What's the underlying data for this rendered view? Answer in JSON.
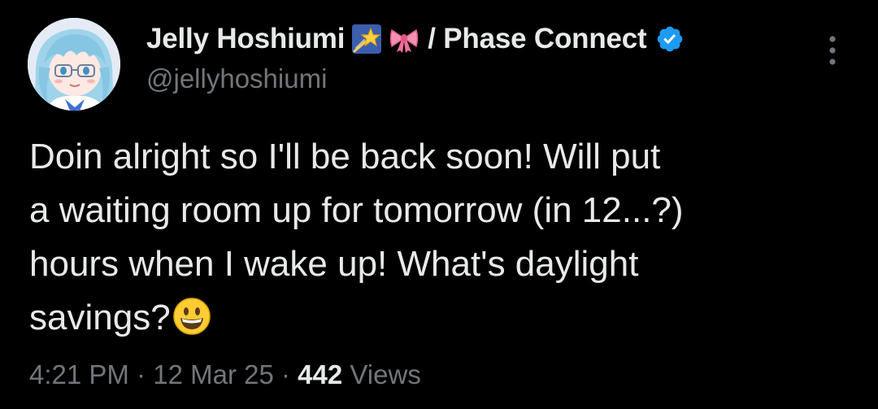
{
  "author": {
    "display_name": "Jelly Hoshiumi",
    "name_emojis": [
      "shooting-star-emoji",
      "ribbon-emoji"
    ],
    "affiliation": "/ Phase Connect",
    "verified": true,
    "verified_color": "#1d9bf0",
    "handle": "@jellyhoshiumi",
    "avatar_icon": "anime-avatar"
  },
  "tweet": {
    "text_lines": [
      "Doin alright so I'll be back soon! Will put",
      "a waiting room up for tomorrow (in 12...?)",
      "hours when I wake up! What's daylight",
      "savings?"
    ],
    "trailing_emoji": "grinning-face-emoji"
  },
  "meta": {
    "time": "4:21 PM",
    "separator": " · ",
    "date": "12 Mar 25",
    "views_count": "442",
    "views_label": " Views"
  },
  "colors": {
    "background": "#000000",
    "primary_text": "#e7e9ea",
    "secondary_text": "#71767b"
  },
  "more_icon": "more-vertical-icon"
}
